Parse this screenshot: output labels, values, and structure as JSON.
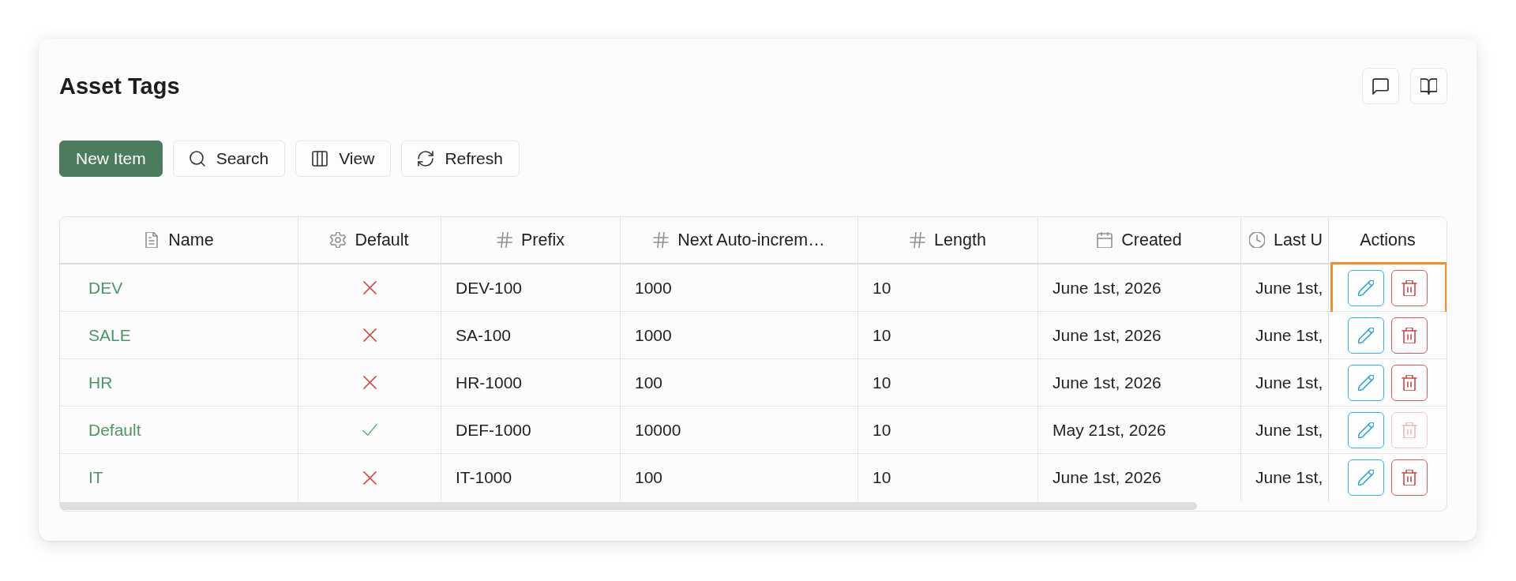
{
  "page": {
    "title": "Asset Tags"
  },
  "toolbar": [
    {
      "label": "New Item",
      "kind": "primary"
    },
    {
      "label": "Search",
      "kind": "search"
    },
    {
      "label": "View",
      "kind": "columns"
    },
    {
      "label": "Refresh",
      "kind": "refresh"
    }
  ],
  "table": {
    "columns": [
      {
        "label": "Name",
        "kind": "text"
      },
      {
        "label": "Default",
        "kind": "boolean"
      },
      {
        "label": "Prefix",
        "kind": "number"
      },
      {
        "label": "Next Auto-increm…",
        "kind": "number"
      },
      {
        "label": "Length",
        "kind": "number"
      },
      {
        "label": "Created",
        "kind": "date"
      },
      {
        "label": "Last U",
        "kind": "time"
      },
      {
        "label": "Actions",
        "kind": "actions"
      }
    ],
    "rows": [
      {
        "name": "DEV",
        "default": false,
        "prefix": "DEV-100",
        "column_4": "1000",
        "length": "10",
        "created": "June 1st, 2026",
        "column_7": "June 1st,",
        "delete_disabled": false,
        "highlighted": true
      },
      {
        "name": "SALE",
        "default": false,
        "prefix": "SA-100",
        "column_4": "1000",
        "length": "10",
        "created": "June 1st, 2026",
        "column_7": "June 1st,",
        "delete_disabled": false,
        "highlighted": false
      },
      {
        "name": "HR",
        "default": false,
        "prefix": "HR-1000",
        "column_4": "100",
        "length": "10",
        "created": "June 1st, 2026",
        "column_7": "June 1st,",
        "delete_disabled": false,
        "highlighted": false
      },
      {
        "name": "Default",
        "default": true,
        "prefix": "DEF-1000",
        "column_4": "10000",
        "length": "10",
        "created": "May 21st, 2026",
        "column_7": "June 1st,",
        "delete_disabled": true,
        "highlighted": false
      },
      {
        "name": "IT",
        "default": false,
        "prefix": "IT-1000",
        "column_4": "100",
        "length": "10",
        "created": "June 1st, 2026",
        "column_7": "June 1st,",
        "delete_disabled": false,
        "highlighted": false
      }
    ]
  }
}
